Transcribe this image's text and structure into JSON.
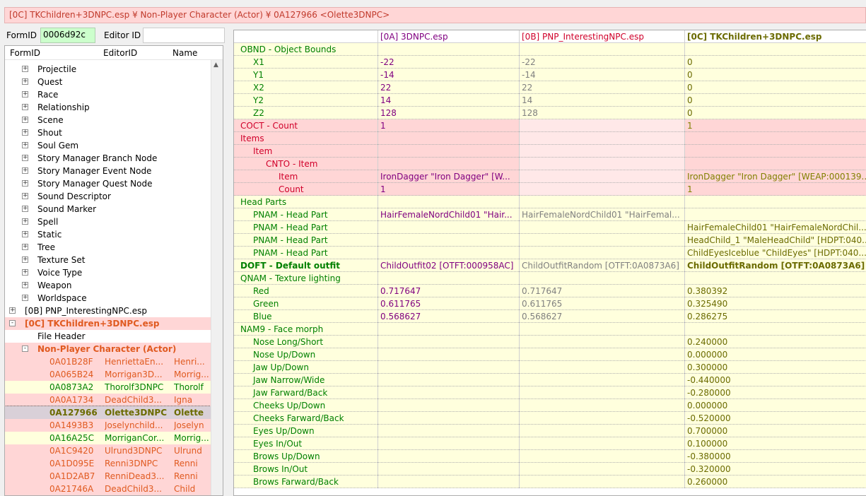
{
  "title": "[0C] TKChildren+3DNPC.esp ¥ Non-Player Character (Actor) ¥ 0A127966 <Olette3DNPC>",
  "search": {
    "formid_label": "FormID",
    "formid_value": "0006d92c",
    "editorid_label": "Editor ID"
  },
  "tree": {
    "headers": [
      "FormID",
      "EditorID",
      "Name"
    ],
    "groups": [
      "Projectile",
      "Quest",
      "Race",
      "Relationship",
      "Scene",
      "Shout",
      "Soul Gem",
      "Story Manager Branch Node",
      "Story Manager Event Node",
      "Story Manager Quest Node",
      "Sound Descriptor",
      "Sound Marker",
      "Spell",
      "Static",
      "Tree",
      "Texture Set",
      "Voice Type",
      "Weapon",
      "Worldspace"
    ],
    "plugin_0b": "[0B] PNP_InterestingNPC.esp",
    "plugin_0c": "[0C] TKChildren+3DNPC.esp",
    "file_header": "File Header",
    "npc_group": "Non-Player Character (Actor)",
    "records": [
      {
        "formid": "0A01B28F",
        "editorid": "HenriettaEn...",
        "name": "Henri...",
        "style": "pink"
      },
      {
        "formid": "0A065B24",
        "editorid": "Morrigan3D...",
        "name": "Morrig...",
        "style": "pink"
      },
      {
        "formid": "0A0873A2",
        "editorid": "Thorolf3DNPC",
        "name": "Thorolf",
        "style": "yellow"
      },
      {
        "formid": "0A0A1734",
        "editorid": "DeadChild3...",
        "name": "Igna",
        "style": "pink"
      },
      {
        "formid": "0A127966",
        "editorid": "Olette3DNPC",
        "name": "Olette",
        "style": "selected"
      },
      {
        "formid": "0A1493B3",
        "editorid": "Joselynchild...",
        "name": "Joselyn",
        "style": "pink"
      },
      {
        "formid": "0A16A25C",
        "editorid": "MorriganCor...",
        "name": "Morrig...",
        "style": "yellow"
      },
      {
        "formid": "0A1C9420",
        "editorid": "Ulrund3DNPC",
        "name": "Ulrund",
        "style": "pink"
      },
      {
        "formid": "0A1D095E",
        "editorid": "Renni3DNPC",
        "name": "Renni",
        "style": "pink"
      },
      {
        "formid": "0A1D2AB7",
        "editorid": "RenniDead3...",
        "name": "Renni",
        "style": "pink"
      },
      {
        "formid": "0A21746A",
        "editorid": "DeadChild3...",
        "name": "Child",
        "style": "pink-orange"
      }
    ]
  },
  "grid": {
    "columns": [
      "",
      "[0A] 3DNPC.esp",
      "[0B] PNP_InterestingNPC.esp",
      "[0C] TKChildren+3DNPC.esp"
    ],
    "rows": [
      {
        "label": "OBND - Object Bounds",
        "indent": 0,
        "c1": "",
        "c2": "",
        "c3": "",
        "bg": "y"
      },
      {
        "label": "X1",
        "indent": 1,
        "c1": "-22",
        "c2": "-22",
        "c3": "0",
        "bg": "y"
      },
      {
        "label": "Y1",
        "indent": 1,
        "c1": "-14",
        "c2": "-14",
        "c3": "0",
        "bg": "y"
      },
      {
        "label": "X2",
        "indent": 1,
        "c1": "22",
        "c2": "22",
        "c3": "0",
        "bg": "y"
      },
      {
        "label": "Y2",
        "indent": 1,
        "c1": "14",
        "c2": "14",
        "c3": "0",
        "bg": "y"
      },
      {
        "label": "Z2",
        "indent": 1,
        "c1": "128",
        "c2": "128",
        "c3": "0",
        "bg": "y"
      },
      {
        "label": "COCT - Count",
        "indent": 0,
        "c1": "1",
        "c2": "",
        "c3": "1",
        "bg": "p"
      },
      {
        "label": "Items",
        "indent": 0,
        "c1": "",
        "c2": "",
        "c3": "",
        "bg": "p"
      },
      {
        "label": "Item",
        "indent": 1,
        "c1": "",
        "c2": "",
        "c3": "",
        "bg": "p"
      },
      {
        "label": "CNTO - Item",
        "indent": 2,
        "c1": "",
        "c2": "",
        "c3": "",
        "bg": "p"
      },
      {
        "label": "Item",
        "indent": 3,
        "c1": "IronDagger \"Iron Dagger\" [W...",
        "c2": "",
        "c3": "IronDagger \"Iron Dagger\" [WEAP:000139...",
        "bg": "p"
      },
      {
        "label": "Count",
        "indent": 3,
        "c1": "1",
        "c2": "",
        "c3": "1",
        "bg": "p"
      },
      {
        "label": "Head Parts",
        "indent": 0,
        "c1": "",
        "c2": "",
        "c3": "",
        "bg": "y"
      },
      {
        "label": "PNAM - Head Part",
        "indent": 1,
        "c1": "HairFemaleNordChild01 \"Hair...",
        "c2": "HairFemaleNordChild01 \"HairFemal...",
        "c3": "",
        "bg": "y"
      },
      {
        "label": "PNAM - Head Part",
        "indent": 1,
        "c1": "",
        "c2": "",
        "c3": "HairFemaleChild01 \"HairFemaleNordChil...",
        "bg": "y"
      },
      {
        "label": "PNAM - Head Part",
        "indent": 1,
        "c1": "",
        "c2": "",
        "c3": "HeadChild_1 \"MaleHeadChild\" [HDPT:040...",
        "bg": "y"
      },
      {
        "label": "PNAM - Head Part",
        "indent": 1,
        "c1": "",
        "c2": "",
        "c3": "ChildEyesIceblue \"ChildEyes\" [HDPT:040...",
        "bg": "y"
      },
      {
        "label": "DOFT - Default outfit",
        "indent": 0,
        "c1": "ChildOutfit02 [OTFT:000958AC]",
        "c2": "ChildOutfitRandom [OTFT:0A0873A6]",
        "c3": "ChildOutfitRandom [OTFT:0A0873A6]",
        "bg": "y",
        "bold": true
      },
      {
        "label": "QNAM - Texture lighting",
        "indent": 0,
        "c1": "",
        "c2": "",
        "c3": "",
        "bg": "y"
      },
      {
        "label": "Red",
        "indent": 1,
        "c1": "0.717647",
        "c2": "0.717647",
        "c3": "0.380392",
        "bg": "y"
      },
      {
        "label": "Green",
        "indent": 1,
        "c1": "0.611765",
        "c2": "0.611765",
        "c3": "0.325490",
        "bg": "y"
      },
      {
        "label": "Blue",
        "indent": 1,
        "c1": "0.568627",
        "c2": "0.568627",
        "c3": "0.286275",
        "bg": "y"
      },
      {
        "label": "NAM9 - Face morph",
        "indent": 0,
        "c1": "",
        "c2": "",
        "c3": "",
        "bg": "y"
      },
      {
        "label": "Nose Long/Short",
        "indent": 1,
        "c1": "",
        "c2": "",
        "c3": "0.240000",
        "bg": "y"
      },
      {
        "label": "Nose Up/Down",
        "indent": 1,
        "c1": "",
        "c2": "",
        "c3": "0.000000",
        "bg": "y"
      },
      {
        "label": "Jaw Up/Down",
        "indent": 1,
        "c1": "",
        "c2": "",
        "c3": "0.300000",
        "bg": "y"
      },
      {
        "label": "Jaw Narrow/Wide",
        "indent": 1,
        "c1": "",
        "c2": "",
        "c3": "-0.440000",
        "bg": "y"
      },
      {
        "label": "Jaw Farward/Back",
        "indent": 1,
        "c1": "",
        "c2": "",
        "c3": "-0.280000",
        "bg": "y"
      },
      {
        "label": "Cheeks Up/Down",
        "indent": 1,
        "c1": "",
        "c2": "",
        "c3": "0.000000",
        "bg": "y"
      },
      {
        "label": "Cheeks Farward/Back",
        "indent": 1,
        "c1": "",
        "c2": "",
        "c3": "-0.520000",
        "bg": "y"
      },
      {
        "label": "Eyes Up/Down",
        "indent": 1,
        "c1": "",
        "c2": "",
        "c3": "0.700000",
        "bg": "y"
      },
      {
        "label": "Eyes In/Out",
        "indent": 1,
        "c1": "",
        "c2": "",
        "c3": "0.100000",
        "bg": "y"
      },
      {
        "label": "Brows Up/Down",
        "indent": 1,
        "c1": "",
        "c2": "",
        "c3": "-0.380000",
        "bg": "y"
      },
      {
        "label": "Brows In/Out",
        "indent": 1,
        "c1": "",
        "c2": "",
        "c3": "-0.320000",
        "bg": "y"
      },
      {
        "label": "Brows Farward/Back",
        "indent": 1,
        "c1": "",
        "c2": "",
        "c3": "0.260000",
        "bg": "y"
      }
    ]
  },
  "colors": {
    "pink": "#ffd6d6",
    "yellow": "#ffffdd",
    "green_text": "#008000",
    "purple_text": "#800080",
    "red_text": "#d0002a"
  }
}
